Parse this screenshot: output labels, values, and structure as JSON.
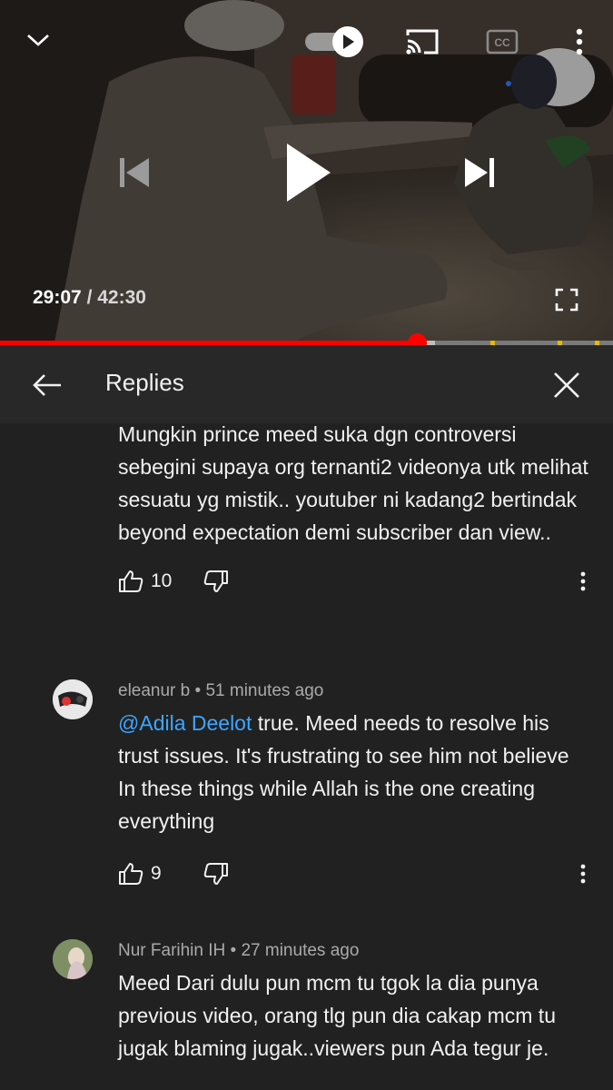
{
  "player": {
    "current_time": "29:07",
    "separator": "/",
    "duration": "42:30",
    "progress": 0.68,
    "buffered_to": 0.71,
    "chapter_marks": [
      0.8,
      0.91,
      0.97
    ],
    "autoplay_on": true,
    "accent_color": "#ff0000",
    "icons": {
      "minimize": "chevron-down-icon",
      "autoplay": "autoplay-toggle-icon",
      "cast": "cast-icon",
      "captions": "captions-icon",
      "more": "more-vert-icon",
      "previous": "previous-icon",
      "play": "play-icon",
      "next": "next-icon",
      "fullscreen": "fullscreen-icon"
    }
  },
  "replies_panel": {
    "title": "Replies",
    "icons": {
      "back": "arrow-back-icon",
      "close": "close-icon"
    }
  },
  "comments": [
    {
      "author": "",
      "time": "",
      "text": "Mungkin prince meed suka dgn controversi sebegini supaya org ternanti2 videonya utk melihat sesuatu yg mistik.. youtuber ni kadang2 bertindak beyond expectation demi subscriber dan view..",
      "likes": "10"
    },
    {
      "author": "eleanur b",
      "time": "51 minutes ago",
      "mention": "@Adila Deelot",
      "text": " true. Meed needs to resolve his trust issues. It's frustrating to see him not believe In these things while Allah is the one creating everything",
      "likes": "9"
    },
    {
      "author": "Nur Farihin IH",
      "time": "27 minutes ago",
      "text": "Meed Dari dulu pun mcm tu tgok la dia punya previous video, orang tlg pun dia cakap mcm tu jugak blaming jugak..viewers pun Ada tegur je.",
      "likes": ""
    }
  ],
  "meta_separator": "•",
  "comment_icons": {
    "like": "thumb-up-icon",
    "dislike": "thumb-down-icon",
    "more": "more-vert-icon"
  }
}
